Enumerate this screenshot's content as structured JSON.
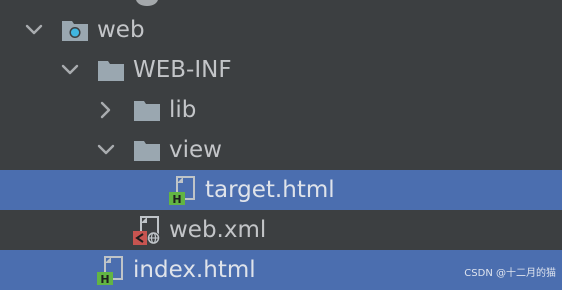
{
  "tree": {
    "items": [
      {
        "label": "web",
        "icon": "web-folder-icon",
        "arrow": "chevron-down-icon",
        "expanded": true,
        "selected": false
      },
      {
        "label": "WEB-INF",
        "icon": "folder-icon",
        "arrow": "chevron-down-icon",
        "expanded": true,
        "selected": false
      },
      {
        "label": "lib",
        "icon": "folder-icon",
        "arrow": "chevron-right-icon",
        "expanded": false,
        "selected": false
      },
      {
        "label": "view",
        "icon": "folder-icon",
        "arrow": "chevron-down-icon",
        "expanded": true,
        "selected": false
      },
      {
        "label": "target.html",
        "icon": "html-file-icon",
        "selected": true
      },
      {
        "label": "web.xml",
        "icon": "xml-file-icon",
        "selected": false
      },
      {
        "label": "index.html",
        "icon": "html-file-icon",
        "selected": true
      }
    ]
  },
  "watermark": "CSDN @十二月的猫",
  "colors": {
    "background": "#3c3f41",
    "selection": "#4b6eaf",
    "folder": "#9aa7b0",
    "html_badge": "#62b543",
    "xml_badge": "#c75450"
  }
}
